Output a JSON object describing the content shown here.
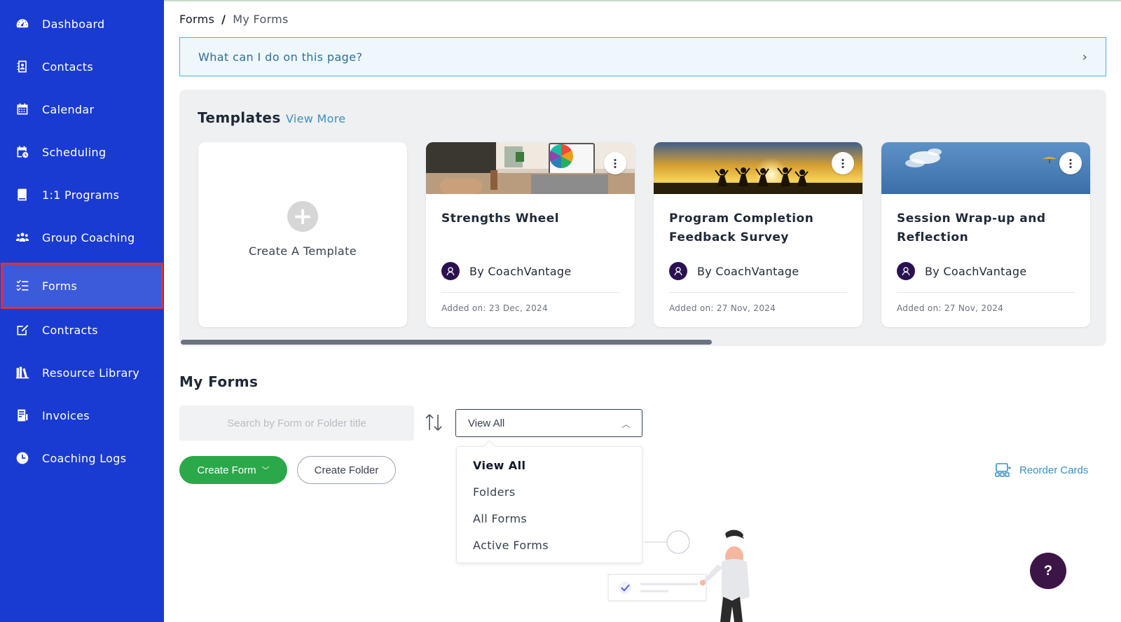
{
  "sidebar": {
    "items": [
      {
        "label": "Dashboard",
        "icon": "dashboard-icon"
      },
      {
        "label": "Contacts",
        "icon": "contacts-icon"
      },
      {
        "label": "Calendar",
        "icon": "calendar-icon"
      },
      {
        "label": "Scheduling",
        "icon": "scheduling-icon"
      },
      {
        "label": "1:1 Programs",
        "icon": "book-icon"
      },
      {
        "label": "Group Coaching",
        "icon": "group-icon"
      },
      {
        "label": "Forms",
        "icon": "forms-icon",
        "active": true
      },
      {
        "label": "Contracts",
        "icon": "contract-icon"
      },
      {
        "label": "Resource Library",
        "icon": "library-icon"
      },
      {
        "label": "Invoices",
        "icon": "invoice-icon"
      },
      {
        "label": "Coaching Logs",
        "icon": "clock-icon"
      }
    ]
  },
  "breadcrumb": {
    "root": "Forms",
    "separator": "/",
    "current": "My Forms"
  },
  "help_banner": {
    "text": "What can I do on this page?"
  },
  "templates": {
    "title": "Templates",
    "view_more": "View More",
    "create_label": "Create A Template",
    "cards": [
      {
        "title": "Strengths Wheel",
        "author": "By CoachVantage",
        "date": "Added on: 23 Dec, 2024"
      },
      {
        "title": "Program Completion Feedback Survey",
        "author": "By CoachVantage",
        "date": "Added on: 27 Nov, 2024"
      },
      {
        "title": "Session Wrap-up and Reflection",
        "author": "By CoachVantage",
        "date": "Added on: 27 Nov, 2024"
      }
    ]
  },
  "my_forms": {
    "title": "My Forms",
    "search_placeholder": "Search by Form or Folder title",
    "filter_value": "View All",
    "filter_options": [
      "View All",
      "Folders",
      "All Forms",
      "Active Forms"
    ],
    "create_form_label": "Create Form",
    "create_folder_label": "Create Folder",
    "reorder_label": "Reorder Cards"
  },
  "help_fab": {
    "label": "?"
  },
  "colors": {
    "sidebar": "#1a3bd1",
    "sidebar_active": "#3b5bdb",
    "active_outline": "#e03131",
    "primary_green": "#2ba84a",
    "link_blue": "#3b8fc4",
    "fab_purple": "#3c1547"
  }
}
